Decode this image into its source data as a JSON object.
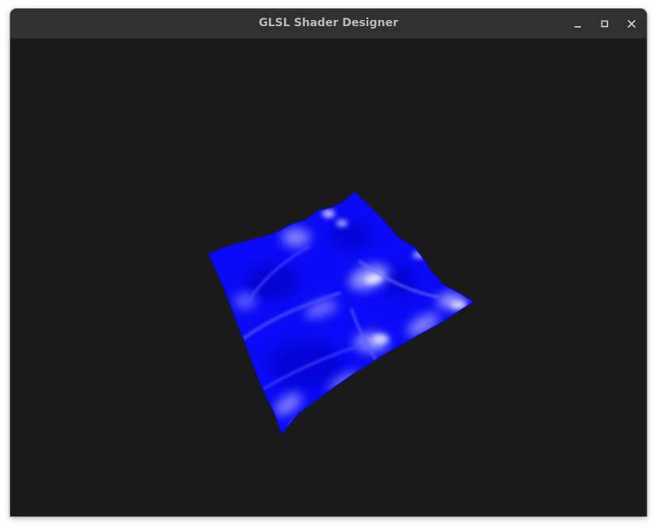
{
  "window": {
    "title": "GLSL Shader Designer",
    "controls": {
      "minimize_icon": "minimize-icon",
      "maximize_icon": "maximize-icon",
      "close_icon": "close-icon"
    }
  },
  "viewport": {
    "background_color": "#1a1a1a",
    "mesh_color": "#0000ff",
    "highlight_color": "#ffffff"
  }
}
